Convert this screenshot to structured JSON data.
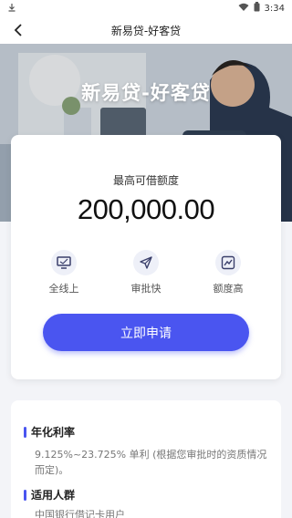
{
  "status_bar": {
    "time": "3:34"
  },
  "nav": {
    "title": "新易贷-好客贷"
  },
  "hero": {
    "title": "新易贷-好客贷"
  },
  "loan_card": {
    "amount_label": "最高可借额度",
    "amount_value": "200,000.00",
    "features": [
      {
        "label": "全线上",
        "icon": "monitor-icon"
      },
      {
        "label": "审批快",
        "icon": "paper-plane-icon"
      },
      {
        "label": "额度高",
        "icon": "chart-icon"
      }
    ],
    "apply_label": "立即申请"
  },
  "info": {
    "rate_title": "年化利率",
    "rate_text": "9.125%~23.725% 单利 (根据您审批时的资质情况而定)。",
    "audience_title": "适用人群",
    "audience_text": "中国银行借记卡用户"
  },
  "colors": {
    "accent": "#4a55f0"
  }
}
